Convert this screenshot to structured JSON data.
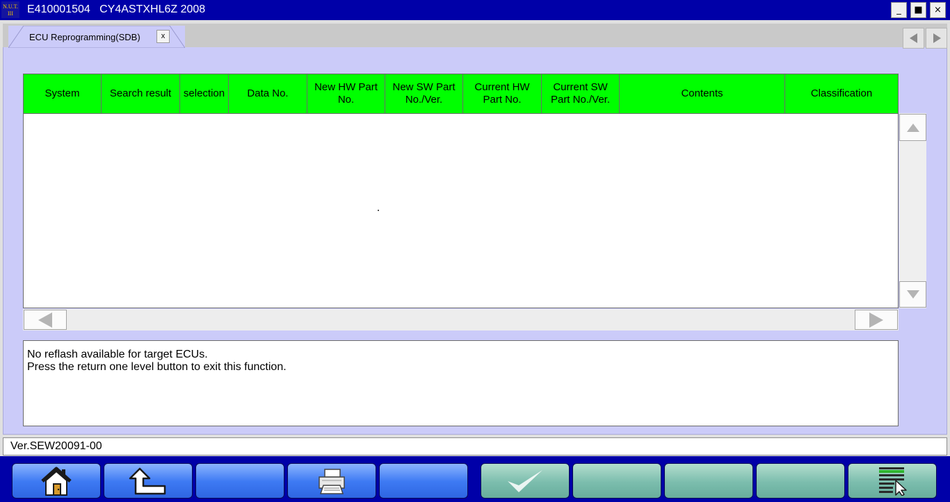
{
  "titlebar": {
    "logo_text": "NUT III",
    "title": "E410001504   CY4ASTXHL6Z 2008",
    "min_glyph": "_",
    "max_glyph": "■",
    "close_glyph": "×"
  },
  "tab": {
    "label": "ECU Reprogramming(SDB)",
    "close_glyph": "x"
  },
  "table": {
    "columns": [
      "System",
      "Search result",
      "selection",
      "Data No.",
      "New HW Part No.",
      "New SW Part No./Ver.",
      "Current HW Part No.",
      "Current SW Part No./Ver.",
      "Contents",
      "Classification"
    ],
    "rows": []
  },
  "message": {
    "lines": [
      "No reflash available for target ECUs.",
      "Press the return one level button to exit this function."
    ]
  },
  "version": "Ver.SEW20091-00",
  "toolbar": {
    "buttons": [
      {
        "name": "home-button",
        "icon": "home-icon",
        "color": "blue"
      },
      {
        "name": "return-one-level-button",
        "icon": "return-arrow-icon",
        "color": "blue"
      },
      {
        "name": "blank-button-3",
        "icon": "",
        "color": "blue"
      },
      {
        "name": "print-button",
        "icon": "printer-icon",
        "color": "blue"
      },
      {
        "name": "blank-button-5",
        "icon": "",
        "color": "blue"
      },
      {
        "name": "confirm-button",
        "icon": "checkmark-icon",
        "color": "teal"
      },
      {
        "name": "blank-button-7",
        "icon": "",
        "color": "teal"
      },
      {
        "name": "blank-button-8",
        "icon": "",
        "color": "teal"
      },
      {
        "name": "blank-button-9",
        "icon": "",
        "color": "teal"
      },
      {
        "name": "select-list-button",
        "icon": "list-cursor-icon",
        "color": "teal"
      }
    ]
  },
  "colors": {
    "title_bar": "#0000a8",
    "header_green": "#00ff00",
    "panel_lavender": "#cbcbf9"
  }
}
